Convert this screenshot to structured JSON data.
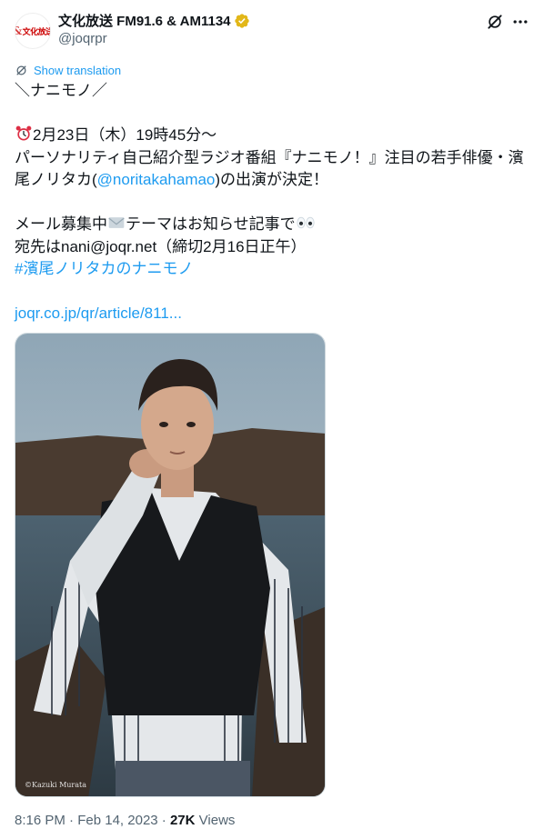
{
  "account": {
    "avatar_text": "文化放送",
    "display_name": "文化放送 FM91.6 & AM1134",
    "handle": "@joqrpr",
    "verified_color": "#e2b719"
  },
  "icons": {
    "verified": "verified-badge-icon",
    "grok": "grok-icon",
    "more": "more-icon",
    "translate": "translate-icon",
    "alarm": "alarm-clock-emoji",
    "envelope": "envelope-emoji",
    "eyes": "eyes-emoji"
  },
  "translate": {
    "label": "Show translation"
  },
  "tweet": {
    "line1": "＼ナニモノ／",
    "line2": "2月23日（木）19時45分～",
    "line3": "パーソナリティ自己紹介型ラジオ番組『ナニモノ！』注目の若手俳優・濱",
    "line4_a": "尾ノリタカ(",
    "line4_mention": "@noritakahamao",
    "line4_b": ")の出演が決定！",
    "line5_a": "メール募集中",
    "line5_b": "テーマはお知らせ記事で",
    "line6": "宛先はnani@joqr.net（締切2月16日正午）",
    "hashtag": "#濱尾ノリタカのナニモノ",
    "link": "joqr.co.jp/qr/article/811..."
  },
  "media": {
    "credit": "©Kazuki Murata"
  },
  "meta": {
    "time": "8:16 PM",
    "sep1": " · ",
    "date": "Feb 14, 2023",
    "sep2": " · ",
    "views_count": "27K",
    "views_label": " Views"
  },
  "colors": {
    "link": "#1d9bf0",
    "text": "#0f1419",
    "muted": "#536471"
  }
}
